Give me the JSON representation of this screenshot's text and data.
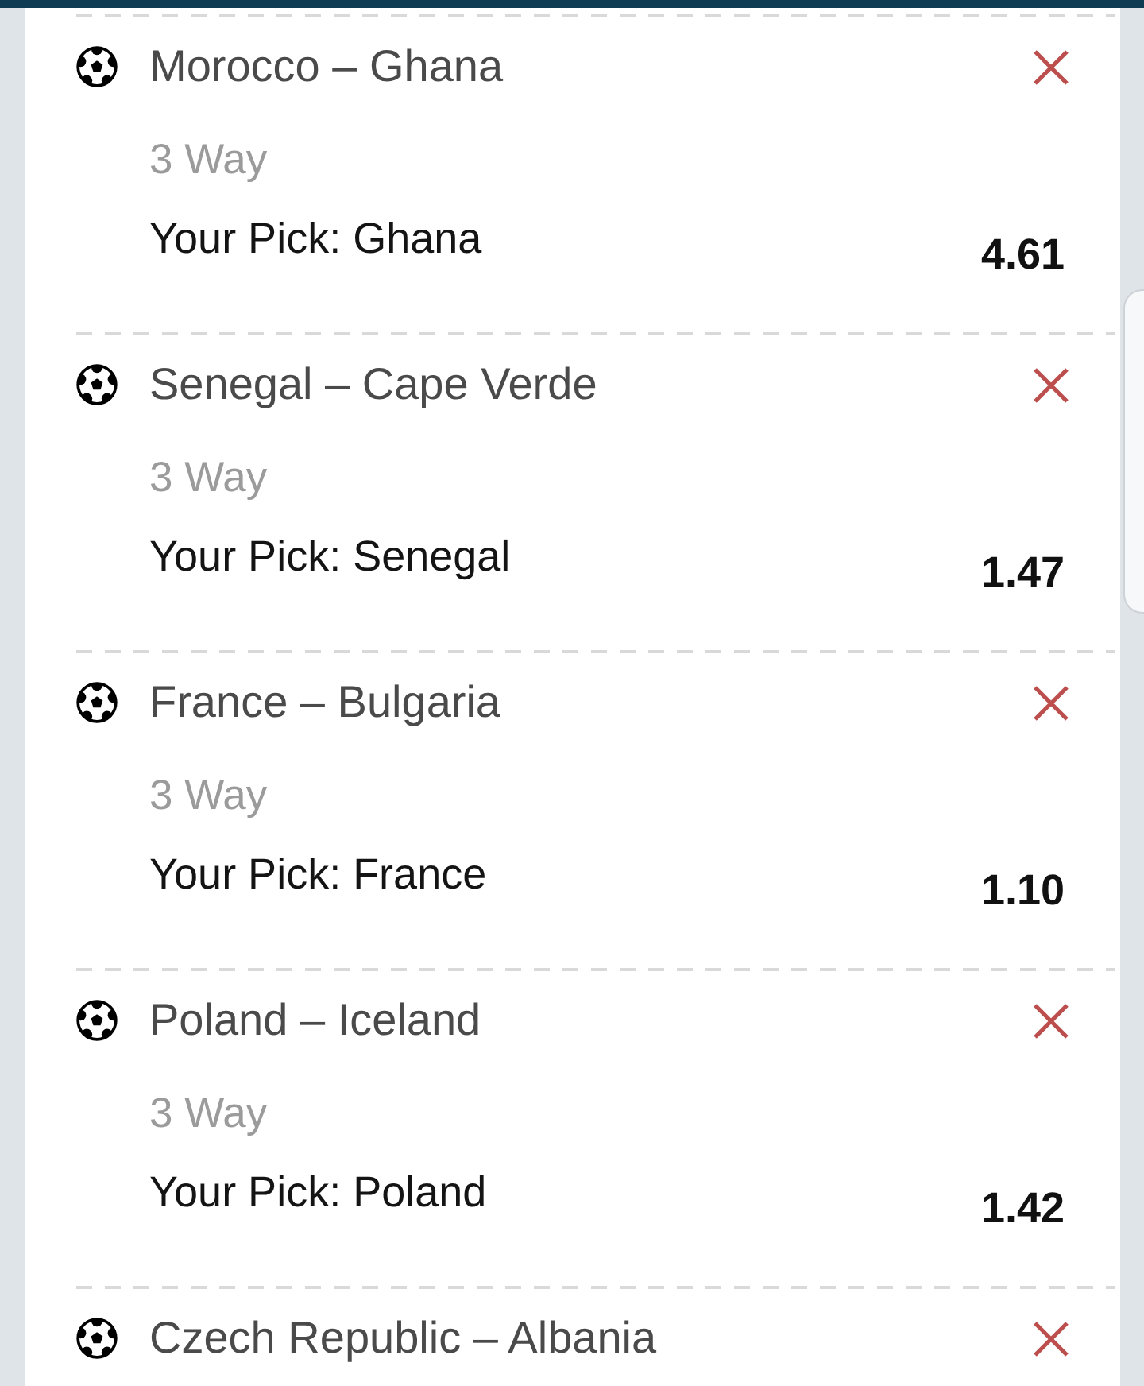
{
  "bets": [
    {
      "match": "Morocco – Ghana",
      "market": "3 Way",
      "pick": "Your Pick: Ghana",
      "odds": "4.61"
    },
    {
      "match": "Senegal – Cape Verde",
      "market": "3 Way",
      "pick": "Your Pick: Senegal",
      "odds": "1.47"
    },
    {
      "match": "France – Bulgaria",
      "market": "3 Way",
      "pick": "Your Pick: France",
      "odds": "1.10"
    },
    {
      "match": "Poland – Iceland",
      "market": "3 Way",
      "pick": "Your Pick: Poland",
      "odds": "1.42"
    },
    {
      "match": "Czech Republic – Albania"
    }
  ]
}
